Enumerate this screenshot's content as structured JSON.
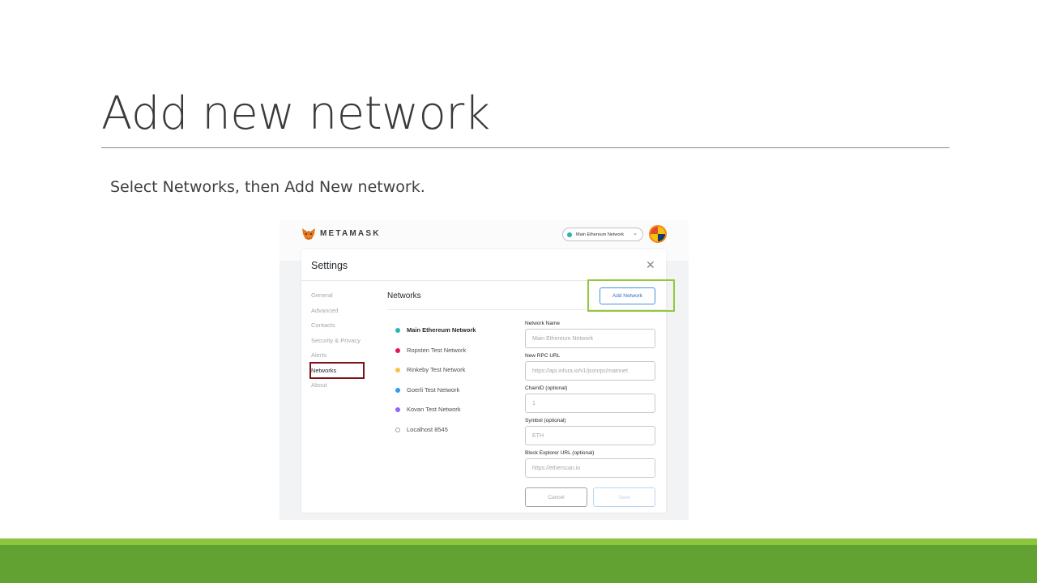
{
  "slide": {
    "title": "Add new network",
    "subtitle": "Select Networks, then Add New network."
  },
  "colors": {
    "footer_light": "#8cc63f",
    "footer_dark": "#62a232",
    "add_network_highlight": "#92c83e",
    "networks_highlight": "#7b1218",
    "metamask_orange": "#f6851b"
  },
  "metamask": {
    "brand": "METAMASK",
    "logo_icon": "fox-icon",
    "network_selector": {
      "label": "Main Ethereum Network",
      "dot_color": "#29b6af"
    },
    "account_icon": "account-avatar-icon"
  },
  "settings": {
    "title": "Settings",
    "close_glyph": "✕",
    "sidebar": [
      {
        "label": "General"
      },
      {
        "label": "Advanced"
      },
      {
        "label": "Contacts"
      },
      {
        "label": "Security & Privacy"
      },
      {
        "label": "Alerts"
      },
      {
        "label": "Networks",
        "active": true
      },
      {
        "label": "About"
      }
    ],
    "section_title": "Networks",
    "add_network_label": "Add Network",
    "networks": [
      {
        "label": "Main Ethereum Network",
        "color": "#29b6af",
        "selected": true
      },
      {
        "label": "Ropsten Test Network",
        "color": "#e91550"
      },
      {
        "label": "Rinkeby Test Network",
        "color": "#f6c343"
      },
      {
        "label": "Goerli Test Network",
        "color": "#3099f2"
      },
      {
        "label": "Kovan Test Network",
        "color": "#9064ff"
      },
      {
        "label": "Localhost 8545",
        "color": "#ffffff"
      }
    ],
    "form": {
      "network_name_label": "Network Name",
      "network_name_value": "Main Ethereum Network",
      "rpc_url_label": "New RPC URL",
      "rpc_url_value": "https://api.infura.io/v1/jsonrpc/mainnet",
      "chain_id_label": "ChainID (optional)",
      "chain_id_value": "1",
      "symbol_label": "Symbol (optional)",
      "symbol_value": "ETH",
      "explorer_label": "Block Explorer URL (optional)",
      "explorer_value": "https://etherscan.io",
      "cancel_label": "Cancel",
      "save_label": "Save"
    }
  }
}
